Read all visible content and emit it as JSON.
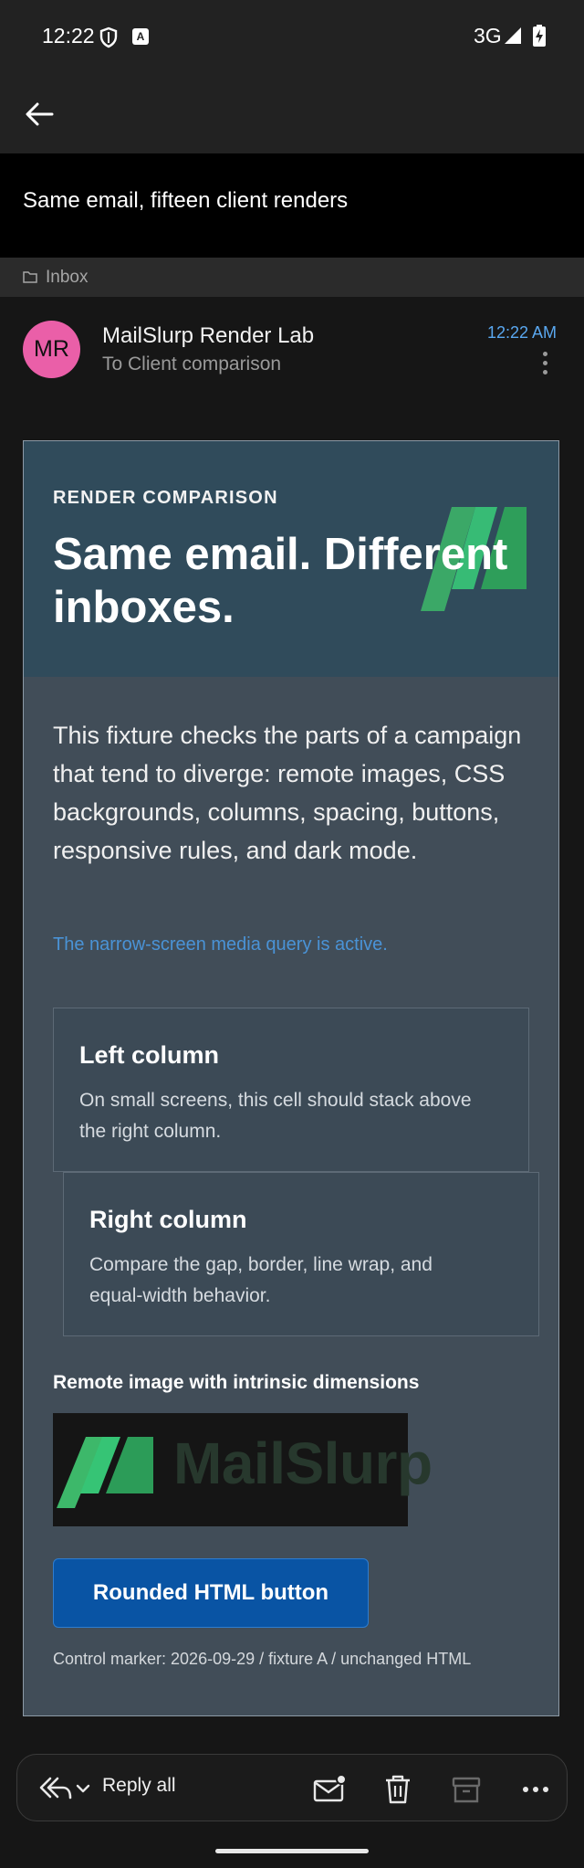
{
  "status_bar": {
    "time": "12:22",
    "network": "3G",
    "icons": [
      "shield-icon",
      "a-badge-icon",
      "signal-icon",
      "battery-charging-icon"
    ]
  },
  "app_bar": {
    "back_icon": "arrow-left-icon"
  },
  "email": {
    "subject": "Same email, fifteen client renders",
    "folder": "Inbox",
    "sender": {
      "initials": "MR",
      "name": "MailSlurp Render Lab",
      "to": "To Client comparison",
      "time": "12:22 AM",
      "avatar_color": "#ea5fa8"
    },
    "body": {
      "eyebrow": "RENDER COMPARISON",
      "headline": "Same email. Different inboxes.",
      "intro": "This fixture checks the parts of a campaign that tend to diverge: remote images, CSS backgrounds, columns, spacing, buttons, responsive rules, and dark mode.",
      "media_note": "The narrow-screen media query is active.",
      "left_column": {
        "title": "Left column",
        "body": "On small screens, this cell should stack above the right column."
      },
      "right_column": {
        "title": "Right column",
        "body": "Compare the gap, border, line wrap, and equal-width behavior."
      },
      "image_label": "Remote image with intrinsic dimensions",
      "image_brand_text": "MailSlurp",
      "button_label": "Rounded HTML button",
      "control_marker": "Control marker: 2026-09-29 / fixture A / unchanged HTML"
    }
  },
  "actions": {
    "reply_all_label": "Reply all",
    "icons": [
      "reply-all-icon",
      "chevron-down-icon",
      "mark-unread-icon",
      "trash-icon",
      "archive-icon",
      "more-icon"
    ]
  },
  "colors": {
    "card_bg": "#414d58",
    "hero_bg": "#304b5b",
    "button_bg": "#0954a4",
    "link": "#4a93d6",
    "brand_green": "#3db86a"
  }
}
